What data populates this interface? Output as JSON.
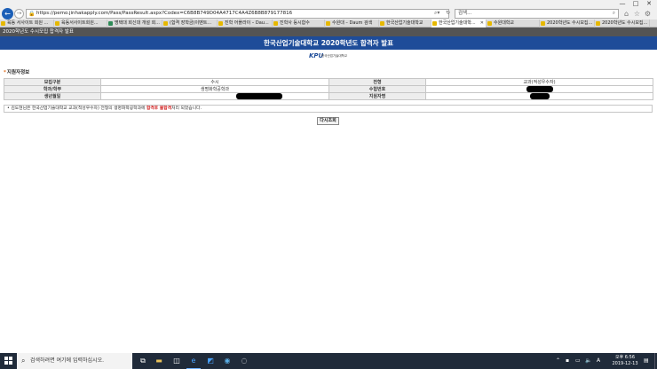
{
  "browser": {
    "url": "https://pemo.jinhakapply.com/Pass/PassResult.aspx?Codex=C6B8B749D04A4717C4A4Z6B8B879177816",
    "search_placeholder": "검색...",
    "window_controls": [
      "—",
      "□",
      "✕"
    ],
    "tabs": [
      {
        "label": "육동 서사이트 회원 ...",
        "color": "#e6b800"
      },
      {
        "label": "육동서사이트회원...",
        "color": "#e6b800"
      },
      {
        "label": "명택대 회신대 개설 회...",
        "color": "#2e8b57"
      },
      {
        "label": "(합격 장학금)이벤트...",
        "color": "#e6b800"
      },
      {
        "label": "진학 어플라이 – Dau...",
        "color": "#e6b800"
      },
      {
        "label": "진학사 등시합수",
        "color": "#e6b800"
      },
      {
        "label": "수원대 – Daum 검색",
        "color": "#e6b800"
      },
      {
        "label": "한국산업기술대학교",
        "color": "#e6b800"
      },
      {
        "label": "한국산업기술대학...",
        "color": "#e6b800",
        "active": true
      },
      {
        "label": "수원대학교",
        "color": "#e6b800"
      },
      {
        "label": "2020학년도 수시모집...",
        "color": "#e6b800"
      },
      {
        "label": "2020학년도 수시모집...",
        "color": "#e6b800"
      }
    ]
  },
  "page": {
    "top_bar_title": "2020학년도 수시모집 합격자 발표",
    "banner_title": "한국산업기술대학교 2020학년도 합격자 발표",
    "logo_text": "KPU",
    "logo_subtext": "한국산업기술대학교",
    "section_title": "지원자정보",
    "table": {
      "labels": {
        "recruit_type": "모집구분",
        "major": "학과/학부",
        "birth": "생년월일",
        "admission": "전형",
        "exam_no": "수험번호",
        "applicant": "지원자명"
      },
      "values": {
        "recruit_type": "수시",
        "major": "생명화학공학과",
        "admission": "교과(적성우수자)"
      }
    },
    "notice": {
      "prefix": "• 김도현님은 한국산업기술대학교 교과(적성우수자) 전형의 생명화학공학과에 ",
      "highlight": "합격후 불합격",
      "suffix": "처리 되었습니다."
    },
    "back_button": "다시조회"
  },
  "taskbar": {
    "search_placeholder": "검색하려면 여기에 입력하십시오.",
    "tray_language": "A",
    "clock_time": "오후 6:56",
    "clock_date": "2019-12-13"
  }
}
